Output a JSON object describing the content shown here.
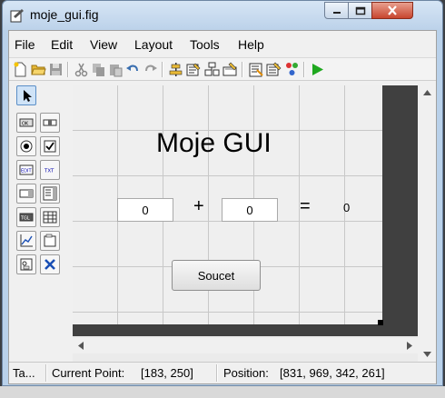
{
  "window": {
    "title": "moje_gui.fig"
  },
  "menu": [
    "File",
    "Edit",
    "View",
    "Layout",
    "Tools",
    "Help"
  ],
  "toolbar": {
    "icons": [
      "new-file-icon",
      "open-folder-icon",
      "save-icon",
      "cut-icon",
      "copy-icon",
      "paste-icon",
      "undo-icon",
      "redo-icon",
      "align-icon",
      "menu-editor-icon",
      "tab-order-icon",
      "toolbar-editor-icon",
      "mfile-editor-icon",
      "property-inspector-icon",
      "object-browser-icon",
      "run-icon"
    ]
  },
  "palette": {
    "tools": [
      "select-icon",
      "push-button-icon",
      "slider-icon",
      "radio-button-icon",
      "checkbox-icon",
      "edit-text-icon",
      "static-text-icon",
      "popup-menu-icon",
      "listbox-icon",
      "toggle-button-icon",
      "table-icon",
      "axes-icon",
      "panel-icon",
      "button-group-icon",
      "activex-icon"
    ]
  },
  "canvas": {
    "title": "Moje GUI",
    "input1_value": "0",
    "plus_label": "+",
    "input2_value": "0",
    "equals_label": "=",
    "result_value": "0",
    "button_label": "Soucet"
  },
  "status": {
    "tag": "Ta...",
    "current_point_label": "Current Point:",
    "current_point_value": "[183, 250]",
    "position_label": "Position:",
    "position_value": "[831, 969, 342, 261]"
  },
  "colors": {
    "run": "#1fa81f",
    "titlebar": "#c5d9ef",
    "close_button": "#c8452e"
  }
}
